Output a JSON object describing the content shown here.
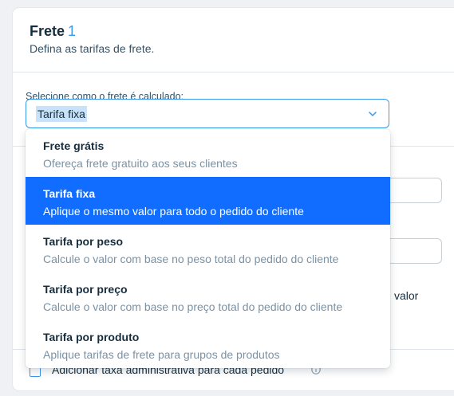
{
  "section": {
    "title": "Frete",
    "count": "1",
    "subtitle": "Defina as tarifas de frete."
  },
  "calc": {
    "label": "Selecione como o frete é calculado:",
    "selected": "Tarifa fixa"
  },
  "options": [
    {
      "title": "Frete grátis",
      "description": "Ofereça frete gratuito aos seus clientes"
    },
    {
      "title": "Tarifa fixa",
      "description": "Aplique o mesmo valor para todo o pedido do cliente"
    },
    {
      "title": "Tarifa por peso",
      "description": "Calcule o valor com base no peso total do pedido do cliente"
    },
    {
      "title": "Tarifa por preço",
      "description": "Calcule o valor com base no preço total do pedido do cliente"
    },
    {
      "title": "Tarifa por produto",
      "description": "Aplique tarifas de frete para grupos de produtos"
    }
  ],
  "background": {
    "partial_text": "valor",
    "admin_fee_label": "Adicionar taxa administrativa para cada pedido"
  },
  "colors": {
    "accent": "#3899ec",
    "selected_option": "#116dff"
  }
}
